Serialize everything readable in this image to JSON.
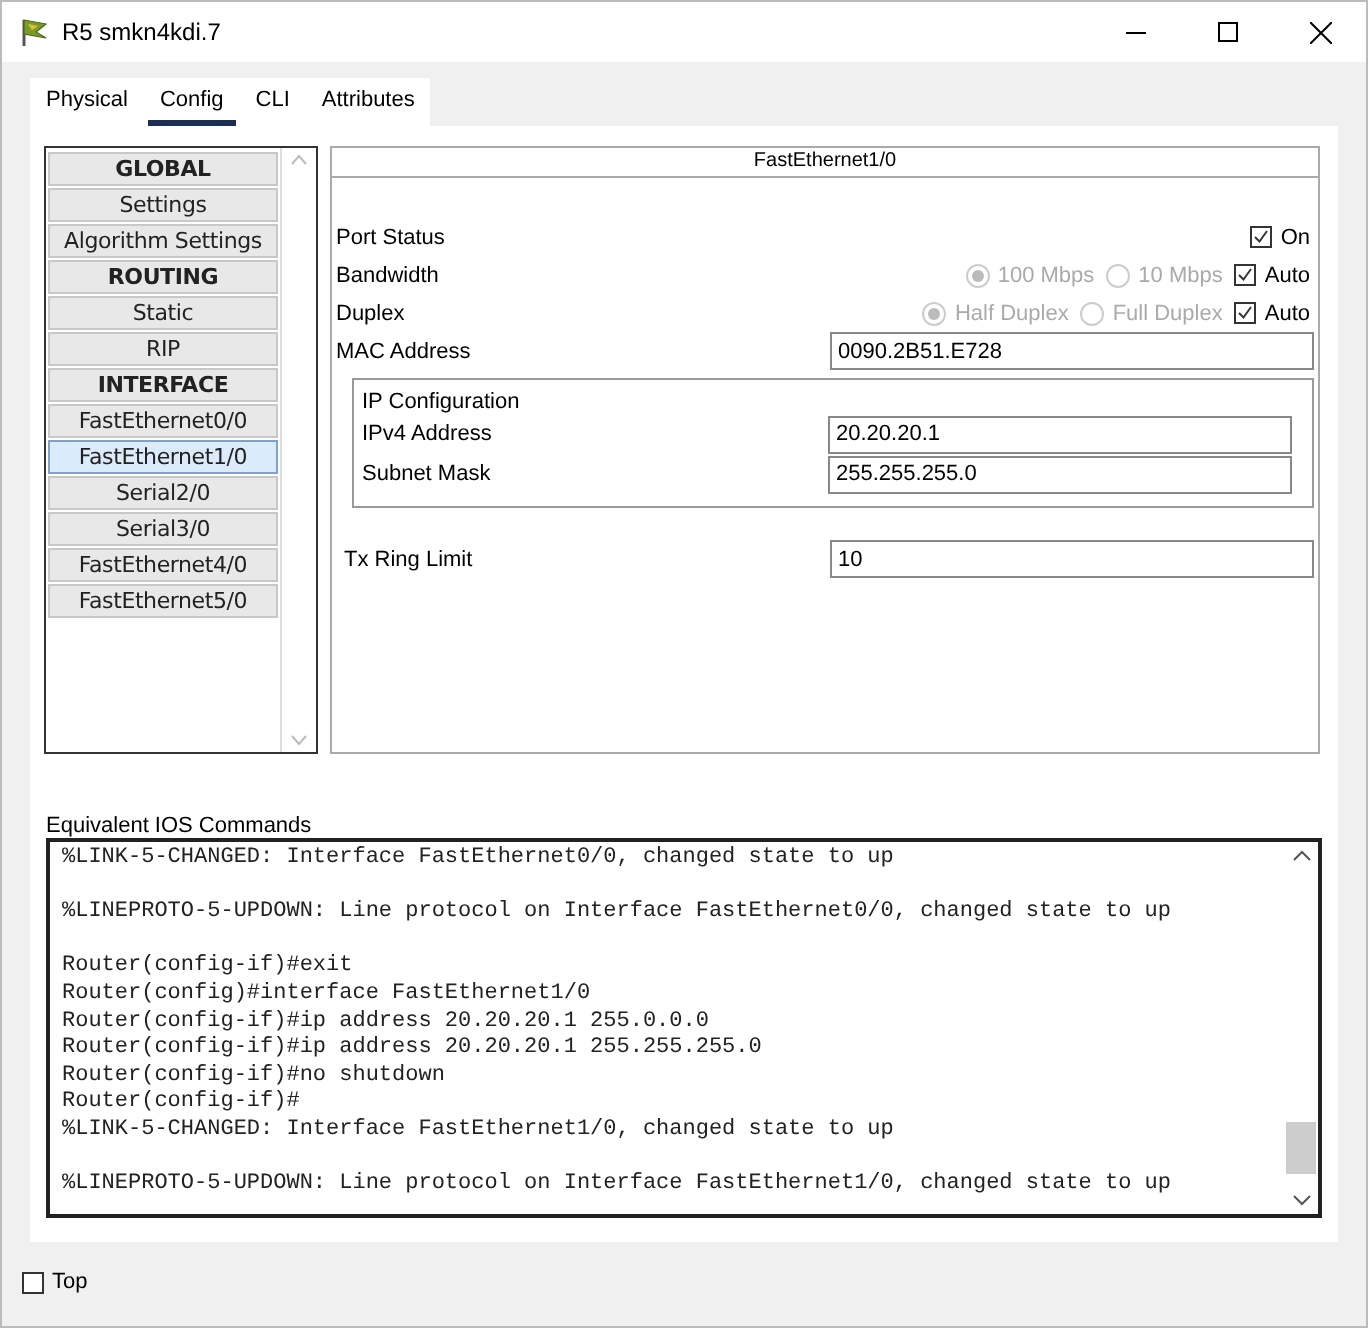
{
  "window": {
    "title": "R5 smkn4kdi.7"
  },
  "tabs": [
    {
      "label": "Physical",
      "selected": false
    },
    {
      "label": "Config",
      "selected": true
    },
    {
      "label": "CLI",
      "selected": false
    },
    {
      "label": "Attributes",
      "selected": false
    }
  ],
  "sidebar": {
    "items": [
      {
        "label": "GLOBAL",
        "kind": "header",
        "selected": false
      },
      {
        "label": "Settings",
        "kind": "item",
        "selected": false
      },
      {
        "label": "Algorithm Settings",
        "kind": "item",
        "selected": false
      },
      {
        "label": "ROUTING",
        "kind": "header",
        "selected": false
      },
      {
        "label": "Static",
        "kind": "item",
        "selected": false
      },
      {
        "label": "RIP",
        "kind": "item",
        "selected": false
      },
      {
        "label": "INTERFACE",
        "kind": "header",
        "selected": false
      },
      {
        "label": "FastEthernet0/0",
        "kind": "item",
        "selected": false
      },
      {
        "label": "FastEthernet1/0",
        "kind": "item",
        "selected": true
      },
      {
        "label": "Serial2/0",
        "kind": "item",
        "selected": false
      },
      {
        "label": "Serial3/0",
        "kind": "item",
        "selected": false
      },
      {
        "label": "FastEthernet4/0",
        "kind": "item",
        "selected": false
      },
      {
        "label": "FastEthernet5/0",
        "kind": "item",
        "selected": false
      }
    ]
  },
  "interface": {
    "title": "FastEthernet1/0",
    "port_status": {
      "label": "Port Status",
      "option": "On",
      "checked": true
    },
    "bandwidth": {
      "label": "Bandwidth",
      "options": [
        {
          "label": "100 Mbps",
          "selected": true,
          "disabled": true
        },
        {
          "label": "10 Mbps",
          "selected": false,
          "disabled": true
        }
      ],
      "auto": {
        "label": "Auto",
        "checked": true
      }
    },
    "duplex": {
      "label": "Duplex",
      "options": [
        {
          "label": "Half Duplex",
          "selected": true,
          "disabled": true
        },
        {
          "label": "Full Duplex",
          "selected": false,
          "disabled": true
        }
      ],
      "auto": {
        "label": "Auto",
        "checked": true
      }
    },
    "mac_address": {
      "label": "MAC Address",
      "value": "0090.2B51.E728"
    },
    "ip_configuration": {
      "title": "IP Configuration",
      "fields": [
        {
          "label": "IPv4 Address",
          "value": "20.20.20.1"
        },
        {
          "label": "Subnet Mask",
          "value": "255.255.255.0"
        }
      ]
    },
    "tx_ring_limit": {
      "label": "Tx Ring Limit",
      "value": "10"
    }
  },
  "console": {
    "label": "Equivalent IOS Commands",
    "lines": [
      {
        "text": "%LINK-5-CHANGED: Interface FastEthernet0/0, changed state to up",
        "blank_after": true
      },
      {
        "text": "%LINEPROTO-5-UPDOWN: Line protocol on Interface FastEthernet0/0, changed state to up",
        "blank_after": true
      },
      {
        "text": "Router(config-if)#exit",
        "blank_after": false
      },
      {
        "text": "Router(config)#interface FastEthernet1/0",
        "blank_after": false
      },
      {
        "text": "Router(config-if)#ip address 20.20.20.1 255.0.0.0",
        "blank_after": false
      },
      {
        "text": "Router(config-if)#ip address 20.20.20.1 255.255.255.0",
        "blank_after": false
      },
      {
        "text": "Router(config-if)#no shutdown",
        "blank_after": false
      },
      {
        "text": "Router(config-if)#",
        "blank_after": false
      },
      {
        "text": "%LINK-5-CHANGED: Interface FastEthernet1/0, changed state to up",
        "blank_after": true
      },
      {
        "text": "%LINEPROTO-5-UPDOWN: Line protocol on Interface FastEthernet1/0, changed state to up",
        "blank_after": false
      }
    ]
  },
  "top_checkbox": {
    "label": "Top",
    "checked": false
  }
}
